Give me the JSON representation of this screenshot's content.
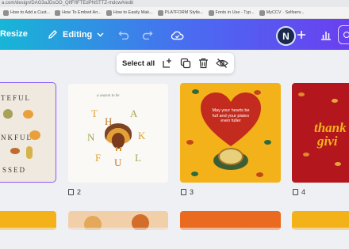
{
  "browser": {
    "url": "a.com/design/DAG3aJDsOO_QIfFfIFTEdPNSTTZ-mdcwA/edit",
    "bookmarks": [
      "How to Add a Cust...",
      "How To Embed An...",
      "How to Easily Mak...",
      "PLATFORM Stylis...",
      "Fonts in Use - Typ...",
      "MyCCV · Selfserv..."
    ]
  },
  "toolbar": {
    "resize_label": "Resize",
    "editing_label": "Editing",
    "avatar_initial": "N"
  },
  "selection_bar": {
    "select_all_label": "Select all"
  },
  "pages": [
    {
      "number": "",
      "words": [
        "TEFUL",
        "NKFUL",
        "SSED"
      ]
    },
    {
      "number": "2",
      "small_title": "a season to be",
      "letters": [
        "T",
        "H",
        "A",
        "N",
        "K",
        "F",
        "U",
        "L"
      ]
    },
    {
      "number": "3",
      "heart_text": "May your hearts be full and your plates even fuller"
    },
    {
      "number": "4",
      "script_text": [
        "thank",
        "givi"
      ]
    }
  ],
  "colors": {
    "toolbar_start": "#17b6d6",
    "toolbar_end": "#6a3ff0",
    "selected_outline": "#8b5cf6",
    "page3_bg": "#f4b21a",
    "page4_bg": "#b3171d"
  }
}
